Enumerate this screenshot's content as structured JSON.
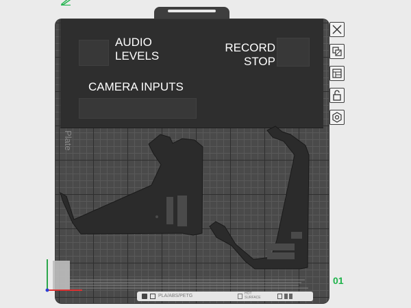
{
  "overlay": {
    "audio_label_line1": "AUDIO",
    "audio_label_line2": "LEVELS",
    "record_label": "RECORD",
    "stop_label": "STOP",
    "camera_label": "CAMERA INPUTS"
  },
  "plate": {
    "name": "Plate",
    "number": "01",
    "filament_type": "PLA/ABS/PETG",
    "surface_line1": "HOT",
    "surface_line2": "SURFACE"
  },
  "toolbar": {
    "items": [
      "close-icon",
      "arrange-icon",
      "layout-icon",
      "lock-icon",
      "settings-icon"
    ]
  },
  "colors": {
    "plate_bg": "#4a4a4a",
    "overlay_bg": "#2e2e2e",
    "part_fill": "#2a2a2a",
    "accent_green": "#1db34a"
  }
}
